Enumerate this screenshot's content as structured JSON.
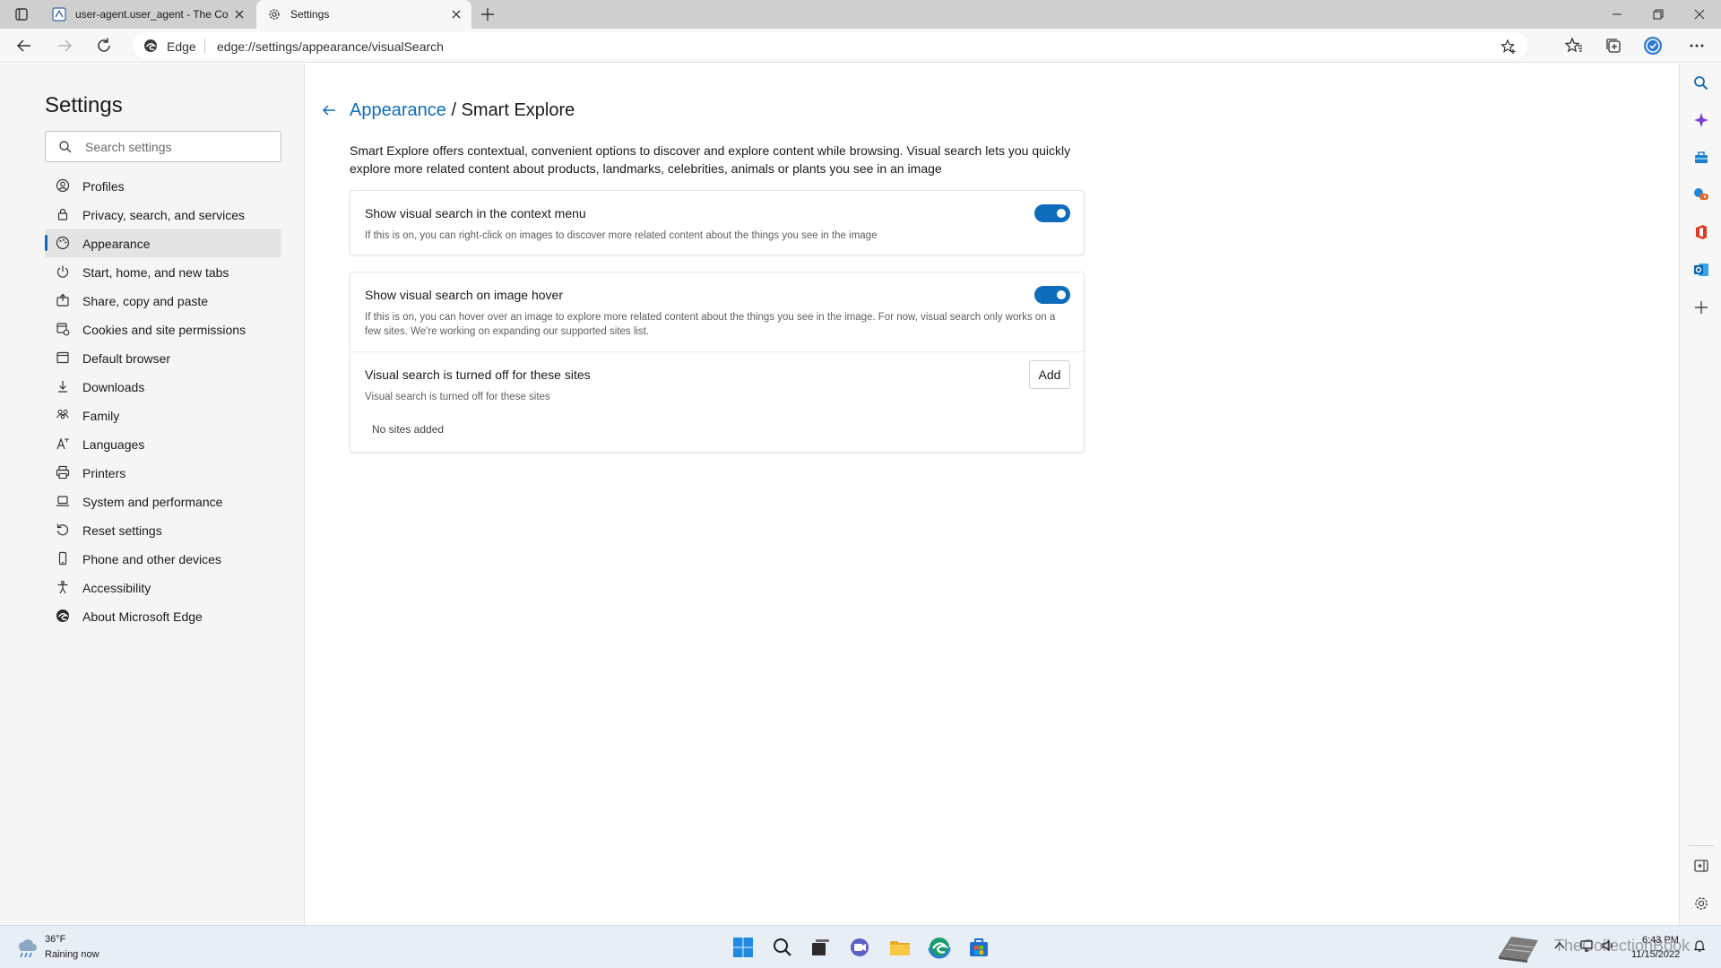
{
  "browser": {
    "tabs": [
      {
        "title": "user-agent.user_agent - The Coll",
        "active": false
      },
      {
        "title": "Settings",
        "active": true
      }
    ],
    "site_label": "Edge",
    "url": "edge://settings/appearance/visualSearch"
  },
  "settings_nav": {
    "title": "Settings",
    "search_placeholder": "Search settings",
    "items": [
      {
        "label": "Profiles",
        "icon": "profile-icon"
      },
      {
        "label": "Privacy, search, and services",
        "icon": "lock-icon"
      },
      {
        "label": "Appearance",
        "icon": "appearance-icon",
        "active": true
      },
      {
        "label": "Start, home, and new tabs",
        "icon": "power-icon"
      },
      {
        "label": "Share, copy and paste",
        "icon": "share-icon"
      },
      {
        "label": "Cookies and site permissions",
        "icon": "cookie-icon"
      },
      {
        "label": "Default browser",
        "icon": "browser-icon"
      },
      {
        "label": "Downloads",
        "icon": "download-icon"
      },
      {
        "label": "Family",
        "icon": "family-icon"
      },
      {
        "label": "Languages",
        "icon": "language-icon"
      },
      {
        "label": "Printers",
        "icon": "printer-icon"
      },
      {
        "label": "System and performance",
        "icon": "laptop-icon"
      },
      {
        "label": "Reset settings",
        "icon": "reset-icon"
      },
      {
        "label": "Phone and other devices",
        "icon": "phone-icon"
      },
      {
        "label": "Accessibility",
        "icon": "accessibility-icon"
      },
      {
        "label": "About Microsoft Edge",
        "icon": "edge-logo-icon"
      }
    ]
  },
  "page": {
    "breadcrumb_parent": "Appearance",
    "breadcrumb_sep": "/",
    "breadcrumb_current": "Smart Explore",
    "description": "Smart Explore offers contextual, convenient options to discover and explore content while browsing. Visual search lets you quickly explore more related content about products, landmarks, celebrities, animals or plants you see in an image",
    "context_menu": {
      "title": "Show visual search in the context menu",
      "subtitle": "If this is on, you can right-click on images to discover more related content about the things you see in the image",
      "enabled": true
    },
    "image_hover": {
      "title": "Show visual search on image hover",
      "subtitle": "If this is on, you can hover over an image to explore more related content about the things you see in the image. For now, visual search only works on a few sites. We're working on expanding our supported sites list.",
      "enabled": true
    },
    "blocked_sites": {
      "title": "Visual search is turned off for these sites",
      "subtitle": "Visual search is turned off for these sites",
      "add_label": "Add",
      "empty_text": "No sites added"
    }
  },
  "taskbar": {
    "weather_temp": "36°F",
    "weather_desc": "Raining now",
    "time": "6:43 PM",
    "date": "11/15/2022",
    "watermark": "TheCollectionBook"
  },
  "colors": {
    "accent": "#0f6cbd",
    "sidebar_bg": "#f5f5f5",
    "tabstrip_bg": "#cfcfcf"
  }
}
